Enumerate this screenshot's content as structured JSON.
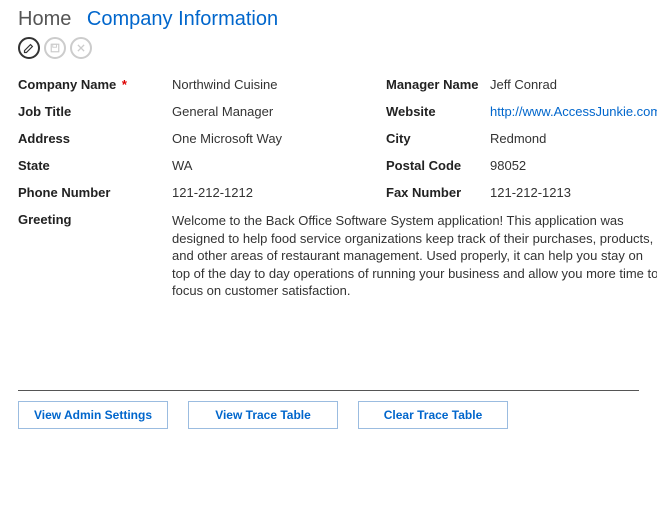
{
  "breadcrumb": {
    "home": "Home",
    "current": "Company Information"
  },
  "fields": {
    "company_name": {
      "label": "Company Name",
      "value": "Northwind Cuisine",
      "required": true
    },
    "manager_name": {
      "label": "Manager Name",
      "value": "Jeff Conrad"
    },
    "job_title": {
      "label": "Job Title",
      "value": "General Manager"
    },
    "website": {
      "label": "Website",
      "value": "http://www.AccessJunkie.com"
    },
    "address": {
      "label": "Address",
      "value": "One Microsoft Way"
    },
    "city": {
      "label": "City",
      "value": "Redmond"
    },
    "state": {
      "label": "State",
      "value": "WA"
    },
    "postal_code": {
      "label": "Postal Code",
      "value": "98052"
    },
    "phone": {
      "label": "Phone Number",
      "value": "121-212-1212"
    },
    "fax": {
      "label": "Fax Number",
      "value": "121-212-1213"
    },
    "greeting": {
      "label": "Greeting",
      "value": "Welcome to the Back Office Software System application! This application was designed to help food service organizations keep track of their purchases, products, and other areas of restaurant management. Used properly, it can help you stay on top of the day to day operations of running your business and allow you more time to focus on customer satisfaction."
    }
  },
  "buttons": {
    "admin": "View Admin Settings",
    "trace": "View Trace Table",
    "clear": "Clear Trace Table"
  },
  "required_mark": "*"
}
